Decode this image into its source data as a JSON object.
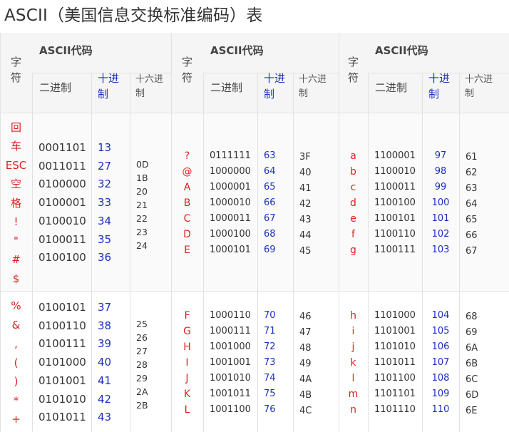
{
  "title": "ASCII（美国信息交换标准编码）表",
  "header": {
    "char": "字\n符",
    "ascii": "ASCII代码",
    "binary": "二进制",
    "decimal": "十进\n制",
    "hex": "十六进\n制"
  },
  "groups": [
    {
      "rows": [
        {
          "chars": "回\n车\nESC\n空\n格\n!\n\"\n#\n$",
          "bin": "0001101\n0011011\n0100000\n0100001\n0100010\n0100011\n0100100",
          "dec": "13\n27\n32\n33\n34\n35\n36",
          "hex": "0D\n1B\n20\n21\n22\n23\n24"
        },
        {
          "chars": "%\n&\n,\n(\n)\n*\n+",
          "bin": "0100101\n0100110\n0100111\n0101000\n0101001\n0101010\n0101011",
          "dec": "37\n38\n39\n40\n41\n42\n43",
          "hex": "25\n26\n27\n28\n29\n2A\n2B"
        }
      ]
    },
    {
      "rows": [
        {
          "chars": "?\n@\nA\nB\nC\nD\nE",
          "bin": "0111111\n1000000\n1000001\n1000010\n1000011\n1000100\n1000101",
          "dec": "63\n64\n65\n66\n67\n68\n69",
          "hex": "3F\n40\n41\n42\n43\n44\n45"
        },
        {
          "chars": "F\nG\nH\nI\nJ\nK\nL",
          "bin": "1000110\n1000111\n1001000\n1001001\n1001010\n1001011\n1001100",
          "dec": "70\n71\n72\n73\n74\n75\n76",
          "hex": "46\n47\n48\n49\n4A\n4B\n4C"
        }
      ]
    },
    {
      "rows": [
        {
          "chars": "a\nb\nc\nd\ne\nf\ng",
          "bin": "1100001\n1100010\n1100011\n1100100\n1100101\n1100110\n1100111",
          "dec": "97\n98\n99\n100\n101\n102\n103",
          "hex": "61\n62\n63\n64\n65\n66\n67"
        },
        {
          "chars": "h\ni\nj\nk\nl\nm\nn",
          "bin": "1101000\n1101001\n1101010\n1101011\n1101100\n1101101\n1101110",
          "dec": "104\n105\n106\n107\n108\n109\n110",
          "hex": "68\n69\n6A\n6B\n6C\n6D\n6E"
        }
      ]
    }
  ],
  "colors": {
    "char": "#e02020",
    "decimal": "#1a2fc0",
    "header_bg": "#f5f5f5",
    "border": "#e2e2e2"
  }
}
